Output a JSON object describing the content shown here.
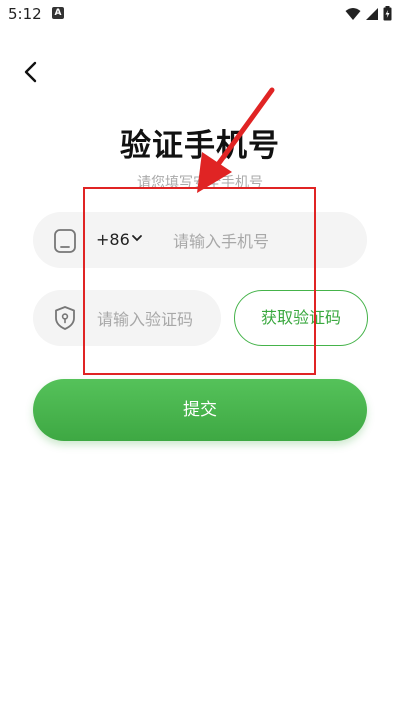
{
  "status_bar": {
    "time": "5:12",
    "notification_icon": "a-icon"
  },
  "header": {
    "back_icon": "chevron-left-icon"
  },
  "page": {
    "title": "验证手机号",
    "subtitle": "请您填写安全手机号"
  },
  "phone": {
    "country_code": "+86",
    "placeholder": "请输入手机号",
    "icon": "phone-icon"
  },
  "code": {
    "placeholder": "请输入验证码",
    "icon": "shield-icon",
    "get_code_label": "获取验证码"
  },
  "submit": {
    "label": "提交"
  },
  "colors": {
    "accent": "#45b34a",
    "annotation": "#e02424"
  }
}
